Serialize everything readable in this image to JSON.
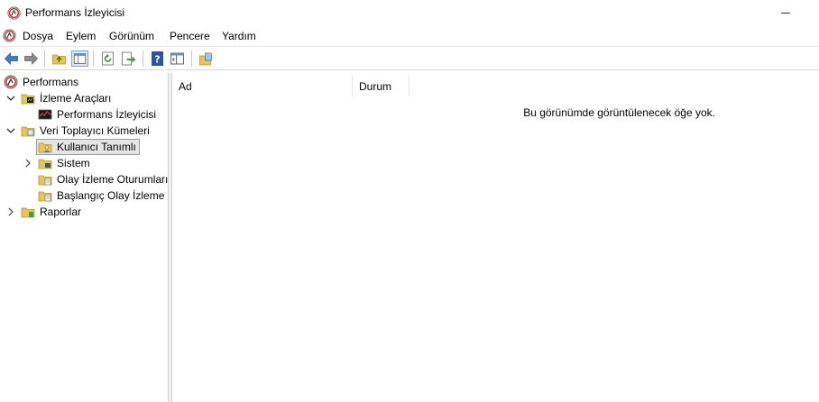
{
  "window": {
    "title": "Performans İzleyicisi"
  },
  "menu": [
    "Dosya",
    "Eylem",
    "Görünüm",
    "Pencere",
    "Yardım"
  ],
  "toolbar": {
    "buttons": [
      "back-arrow-icon",
      "forward-arrow-icon",
      "up-folder-icon",
      "show-hide-tree-icon",
      "refresh-icon",
      "export-list-icon",
      "help-icon",
      "properties-icon",
      "new-collector-set-icon"
    ]
  },
  "tree": {
    "root": "Performans",
    "monitoring_tools": "İzleme Araçları",
    "perf_monitor": "Performans İzleyicisi",
    "data_collector_sets": "Veri Toplayıcı Kümeleri",
    "user_defined": "Kullanıcı Tanımlı",
    "system": "Sistem",
    "event_trace_sessions": "Olay İzleme Oturumları",
    "startup_event_trace": "Başlangıç Olay İzleme Oturumları",
    "reports": "Raporlar"
  },
  "list": {
    "columns": [
      "Ad",
      "Durum"
    ],
    "empty_message": "Bu görünümde görüntülenecek öğe yok."
  },
  "colors": {
    "accent": "#3c7fc6",
    "folder": "#e8c35a",
    "status_red": "#cc2222"
  }
}
